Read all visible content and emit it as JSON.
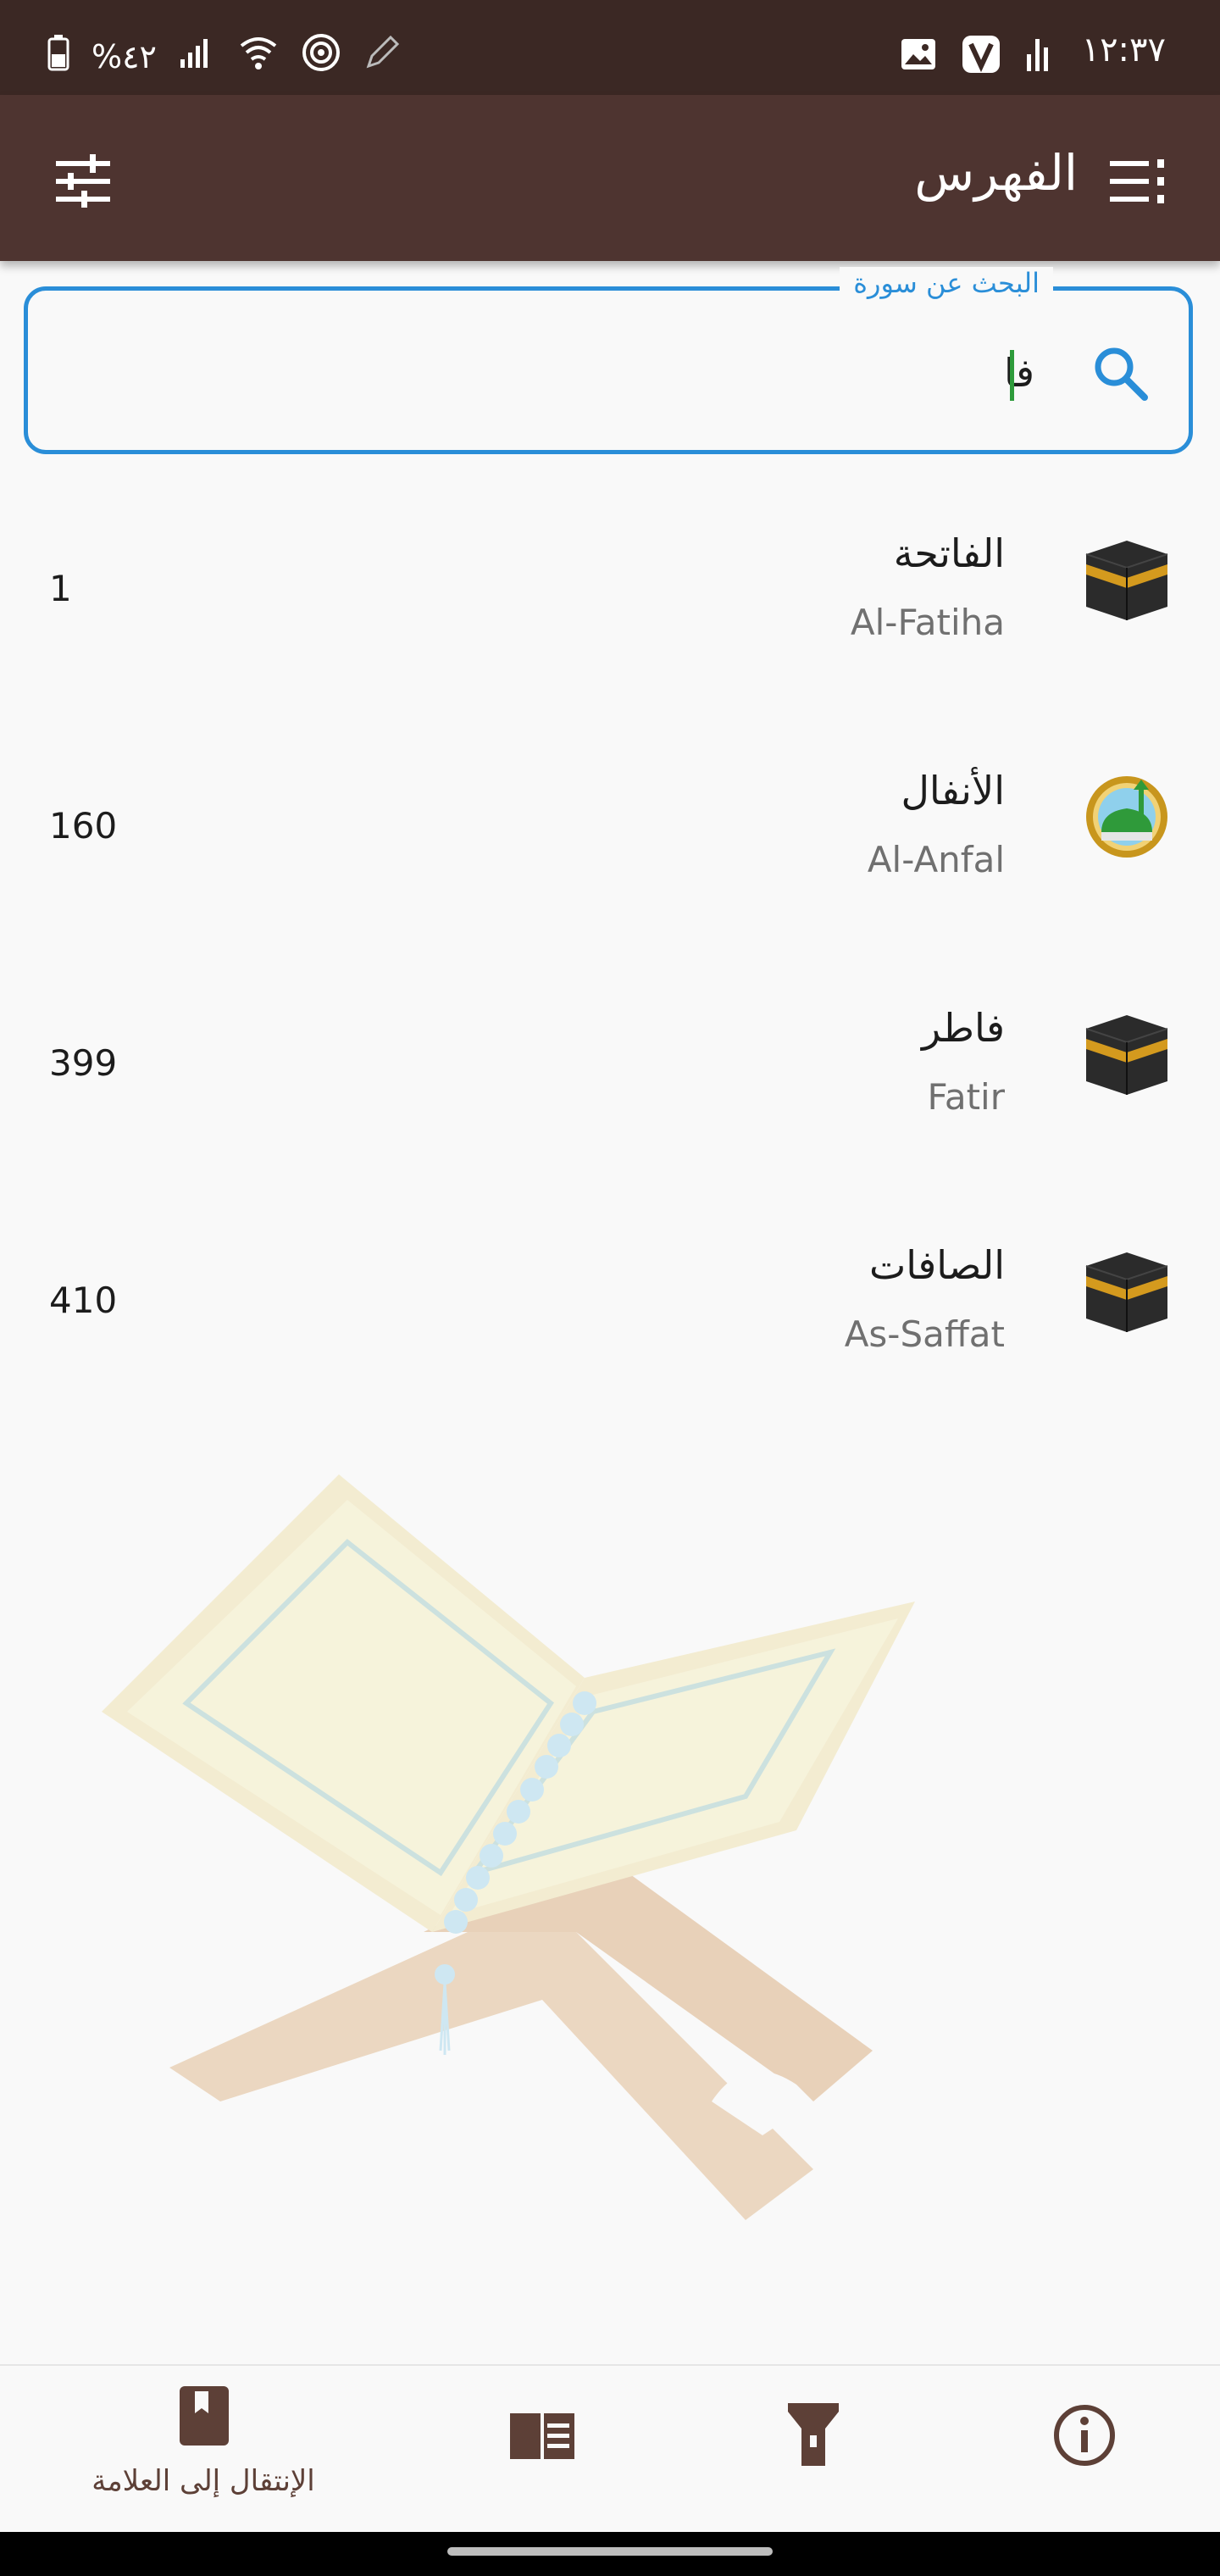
{
  "status_bar": {
    "time": "١٢:٣٧",
    "battery": "%٤٢"
  },
  "app_bar": {
    "title": "الفهرس"
  },
  "search": {
    "label": "البحث عن سورة",
    "value": "فا"
  },
  "suras": [
    {
      "name": "الفاتحة",
      "latin": "Al-Fatiha",
      "page": "1",
      "icon": "kaaba-icon"
    },
    {
      "name": "الأنفال",
      "latin": "Al-Anfal",
      "page": "160",
      "icon": "mosque-icon"
    },
    {
      "name": "فاطر",
      "latin": "Fatir",
      "page": "399",
      "icon": "kaaba-icon"
    },
    {
      "name": "الصافات",
      "latin": "As-Saffat",
      "page": "410",
      "icon": "kaaba-icon"
    }
  ],
  "bottom_nav": {
    "bookmark_label": "الإنتقال إلى العلامة"
  },
  "colors": {
    "status_bar": "#3b2824",
    "app_bar": "#4e3430",
    "accent": "#2a8ed8",
    "nav_icon": "#5d4037"
  }
}
